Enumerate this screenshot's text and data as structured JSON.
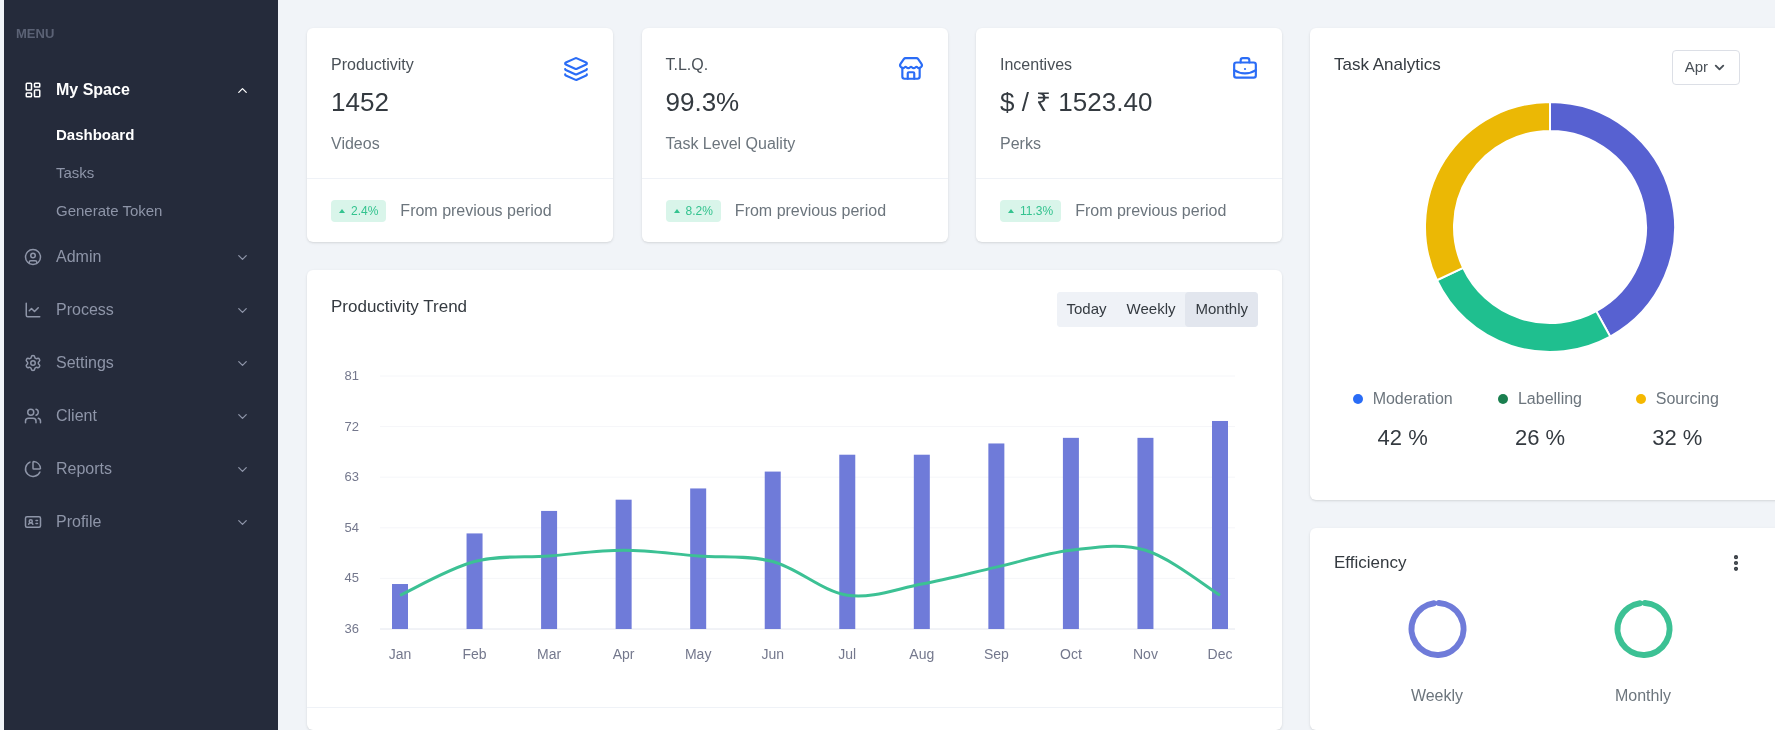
{
  "sidebar": {
    "heading": "MENU",
    "items": [
      {
        "label": "My Space",
        "expanded": true,
        "children": [
          {
            "label": "Dashboard",
            "selected": true
          },
          {
            "label": "Tasks",
            "selected": false
          },
          {
            "label": "Generate Token",
            "selected": false
          }
        ]
      },
      {
        "label": "Admin",
        "expanded": false
      },
      {
        "label": "Process",
        "expanded": false
      },
      {
        "label": "Settings",
        "expanded": false
      },
      {
        "label": "Client",
        "expanded": false
      },
      {
        "label": "Reports",
        "expanded": false
      },
      {
        "label": "Profile",
        "expanded": false
      }
    ]
  },
  "stats": [
    {
      "title": "Productivity",
      "value": "1452",
      "subtitle": "Videos",
      "change": "2.4%",
      "footer": "From previous period"
    },
    {
      "title": "T.L.Q.",
      "value": "99.3%",
      "subtitle": "Task Level Quality",
      "change": "8.2%",
      "footer": "From previous period"
    },
    {
      "title": "Incentives",
      "value": "$ / ₹ 1523.40",
      "subtitle": "Perks",
      "change": "11.3%",
      "footer": "From previous period"
    }
  ],
  "trend": {
    "title": "Productivity Trend",
    "tabs": [
      {
        "label": "Today",
        "selected": false
      },
      {
        "label": "Weekly",
        "selected": false
      },
      {
        "label": "Monthly",
        "selected": true
      }
    ],
    "chart_data": {
      "type": "bar",
      "categories": [
        "Jan",
        "Feb",
        "Mar",
        "Apr",
        "May",
        "Jun",
        "Jul",
        "Aug",
        "Sep",
        "Oct",
        "Nov",
        "Dec"
      ],
      "ylim": [
        36,
        81
      ],
      "grid": true,
      "yticks": [
        36,
        45,
        54,
        63,
        72,
        81
      ],
      "series": [
        {
          "type": "bar",
          "color": "#6f7bd9",
          "values": [
            44,
            53,
            57,
            59,
            61,
            64,
            67,
            67,
            69,
            70,
            70,
            73
          ]
        },
        {
          "type": "line",
          "color": "#3cc194",
          "values": [
            42,
            48,
            49,
            50,
            49,
            48,
            42,
            44,
            47,
            50,
            50,
            42
          ]
        }
      ]
    }
  },
  "analytics": {
    "title": "Task Analytics",
    "month": "Apr",
    "chart_data": {
      "type": "donut",
      "values": [
        42,
        26,
        32
      ],
      "colors": [
        "#5761d1",
        "#1fbf8f",
        "#ebb805"
      ]
    },
    "legend": [
      {
        "label": "Moderation",
        "value": "42 %",
        "color": "#2a6cf6"
      },
      {
        "label": "Labelling",
        "value": "26 %",
        "color": "#1a7f4f"
      },
      {
        "label": "Sourcing",
        "value": "32 %",
        "color": "#f5b800"
      }
    ]
  },
  "efficiency": {
    "title": "Efficiency",
    "gauges": [
      {
        "label": "Weekly",
        "color": "#6f7bd9"
      },
      {
        "label": "Monthly",
        "color": "#3cc194"
      }
    ]
  }
}
